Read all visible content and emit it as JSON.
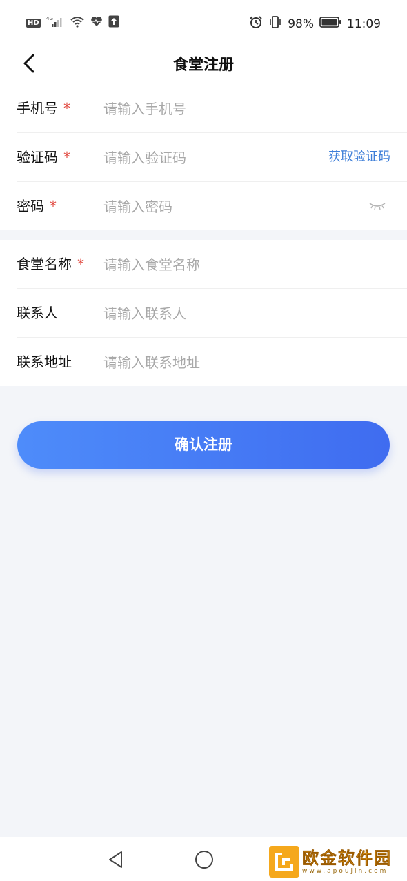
{
  "status_bar": {
    "hd": "HD",
    "network": "4G",
    "battery_percent": "98%",
    "time": "11:09"
  },
  "header": {
    "title": "食堂注册"
  },
  "form_account": {
    "phone": {
      "label": "手机号",
      "required_mark": "*",
      "placeholder": "请输入手机号"
    },
    "code": {
      "label": "验证码",
      "required_mark": "*",
      "placeholder": "请输入验证码",
      "action": "获取验证码"
    },
    "password": {
      "label": "密码",
      "required_mark": "*",
      "placeholder": "请输入密码"
    }
  },
  "form_canteen": {
    "name": {
      "label": "食堂名称",
      "required_mark": "*",
      "placeholder": "请输入食堂名称"
    },
    "contact": {
      "label": "联系人",
      "placeholder": "请输入联系人"
    },
    "address": {
      "label": "联系地址",
      "placeholder": "请输入联系地址"
    }
  },
  "submit_label": "确认注册",
  "watermark": {
    "name": "欧金软件园",
    "url": "www.apoujin.com"
  },
  "colors": {
    "accent": "#4170f0",
    "link": "#3d7ed8",
    "required": "#e0463d",
    "background": "#f3f5f9"
  }
}
